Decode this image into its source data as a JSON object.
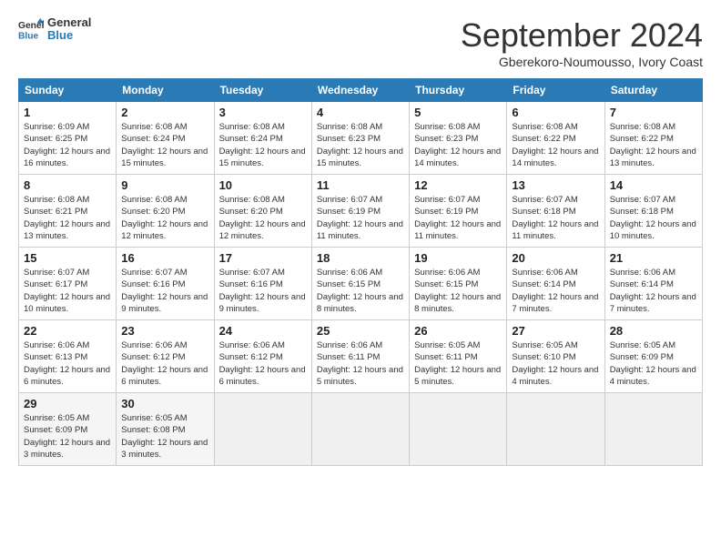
{
  "header": {
    "logo_general": "General",
    "logo_blue": "Blue",
    "month": "September 2024",
    "location": "Gberekoro-Noumousso, Ivory Coast"
  },
  "weekdays": [
    "Sunday",
    "Monday",
    "Tuesday",
    "Wednesday",
    "Thursday",
    "Friday",
    "Saturday"
  ],
  "weeks": [
    [
      {
        "day": "1",
        "sunrise": "6:09 AM",
        "sunset": "6:25 PM",
        "daylight": "12 hours and 16 minutes."
      },
      {
        "day": "2",
        "sunrise": "6:08 AM",
        "sunset": "6:24 PM",
        "daylight": "12 hours and 15 minutes."
      },
      {
        "day": "3",
        "sunrise": "6:08 AM",
        "sunset": "6:24 PM",
        "daylight": "12 hours and 15 minutes."
      },
      {
        "day": "4",
        "sunrise": "6:08 AM",
        "sunset": "6:23 PM",
        "daylight": "12 hours and 15 minutes."
      },
      {
        "day": "5",
        "sunrise": "6:08 AM",
        "sunset": "6:23 PM",
        "daylight": "12 hours and 14 minutes."
      },
      {
        "day": "6",
        "sunrise": "6:08 AM",
        "sunset": "6:22 PM",
        "daylight": "12 hours and 14 minutes."
      },
      {
        "day": "7",
        "sunrise": "6:08 AM",
        "sunset": "6:22 PM",
        "daylight": "12 hours and 13 minutes."
      }
    ],
    [
      {
        "day": "8",
        "sunrise": "6:08 AM",
        "sunset": "6:21 PM",
        "daylight": "12 hours and 13 minutes."
      },
      {
        "day": "9",
        "sunrise": "6:08 AM",
        "sunset": "6:20 PM",
        "daylight": "12 hours and 12 minutes."
      },
      {
        "day": "10",
        "sunrise": "6:08 AM",
        "sunset": "6:20 PM",
        "daylight": "12 hours and 12 minutes."
      },
      {
        "day": "11",
        "sunrise": "6:07 AM",
        "sunset": "6:19 PM",
        "daylight": "12 hours and 11 minutes."
      },
      {
        "day": "12",
        "sunrise": "6:07 AM",
        "sunset": "6:19 PM",
        "daylight": "12 hours and 11 minutes."
      },
      {
        "day": "13",
        "sunrise": "6:07 AM",
        "sunset": "6:18 PM",
        "daylight": "12 hours and 11 minutes."
      },
      {
        "day": "14",
        "sunrise": "6:07 AM",
        "sunset": "6:18 PM",
        "daylight": "12 hours and 10 minutes."
      }
    ],
    [
      {
        "day": "15",
        "sunrise": "6:07 AM",
        "sunset": "6:17 PM",
        "daylight": "12 hours and 10 minutes."
      },
      {
        "day": "16",
        "sunrise": "6:07 AM",
        "sunset": "6:16 PM",
        "daylight": "12 hours and 9 minutes."
      },
      {
        "day": "17",
        "sunrise": "6:07 AM",
        "sunset": "6:16 PM",
        "daylight": "12 hours and 9 minutes."
      },
      {
        "day": "18",
        "sunrise": "6:06 AM",
        "sunset": "6:15 PM",
        "daylight": "12 hours and 8 minutes."
      },
      {
        "day": "19",
        "sunrise": "6:06 AM",
        "sunset": "6:15 PM",
        "daylight": "12 hours and 8 minutes."
      },
      {
        "day": "20",
        "sunrise": "6:06 AM",
        "sunset": "6:14 PM",
        "daylight": "12 hours and 7 minutes."
      },
      {
        "day": "21",
        "sunrise": "6:06 AM",
        "sunset": "6:14 PM",
        "daylight": "12 hours and 7 minutes."
      }
    ],
    [
      {
        "day": "22",
        "sunrise": "6:06 AM",
        "sunset": "6:13 PM",
        "daylight": "12 hours and 6 minutes."
      },
      {
        "day": "23",
        "sunrise": "6:06 AM",
        "sunset": "6:12 PM",
        "daylight": "12 hours and 6 minutes."
      },
      {
        "day": "24",
        "sunrise": "6:06 AM",
        "sunset": "6:12 PM",
        "daylight": "12 hours and 6 minutes."
      },
      {
        "day": "25",
        "sunrise": "6:06 AM",
        "sunset": "6:11 PM",
        "daylight": "12 hours and 5 minutes."
      },
      {
        "day": "26",
        "sunrise": "6:05 AM",
        "sunset": "6:11 PM",
        "daylight": "12 hours and 5 minutes."
      },
      {
        "day": "27",
        "sunrise": "6:05 AM",
        "sunset": "6:10 PM",
        "daylight": "12 hours and 4 minutes."
      },
      {
        "day": "28",
        "sunrise": "6:05 AM",
        "sunset": "6:09 PM",
        "daylight": "12 hours and 4 minutes."
      }
    ],
    [
      {
        "day": "29",
        "sunrise": "6:05 AM",
        "sunset": "6:09 PM",
        "daylight": "12 hours and 3 minutes."
      },
      {
        "day": "30",
        "sunrise": "6:05 AM",
        "sunset": "6:08 PM",
        "daylight": "12 hours and 3 minutes."
      },
      {
        "day": "",
        "sunrise": "",
        "sunset": "",
        "daylight": ""
      },
      {
        "day": "",
        "sunrise": "",
        "sunset": "",
        "daylight": ""
      },
      {
        "day": "",
        "sunrise": "",
        "sunset": "",
        "daylight": ""
      },
      {
        "day": "",
        "sunrise": "",
        "sunset": "",
        "daylight": ""
      },
      {
        "day": "",
        "sunrise": "",
        "sunset": "",
        "daylight": ""
      }
    ]
  ]
}
